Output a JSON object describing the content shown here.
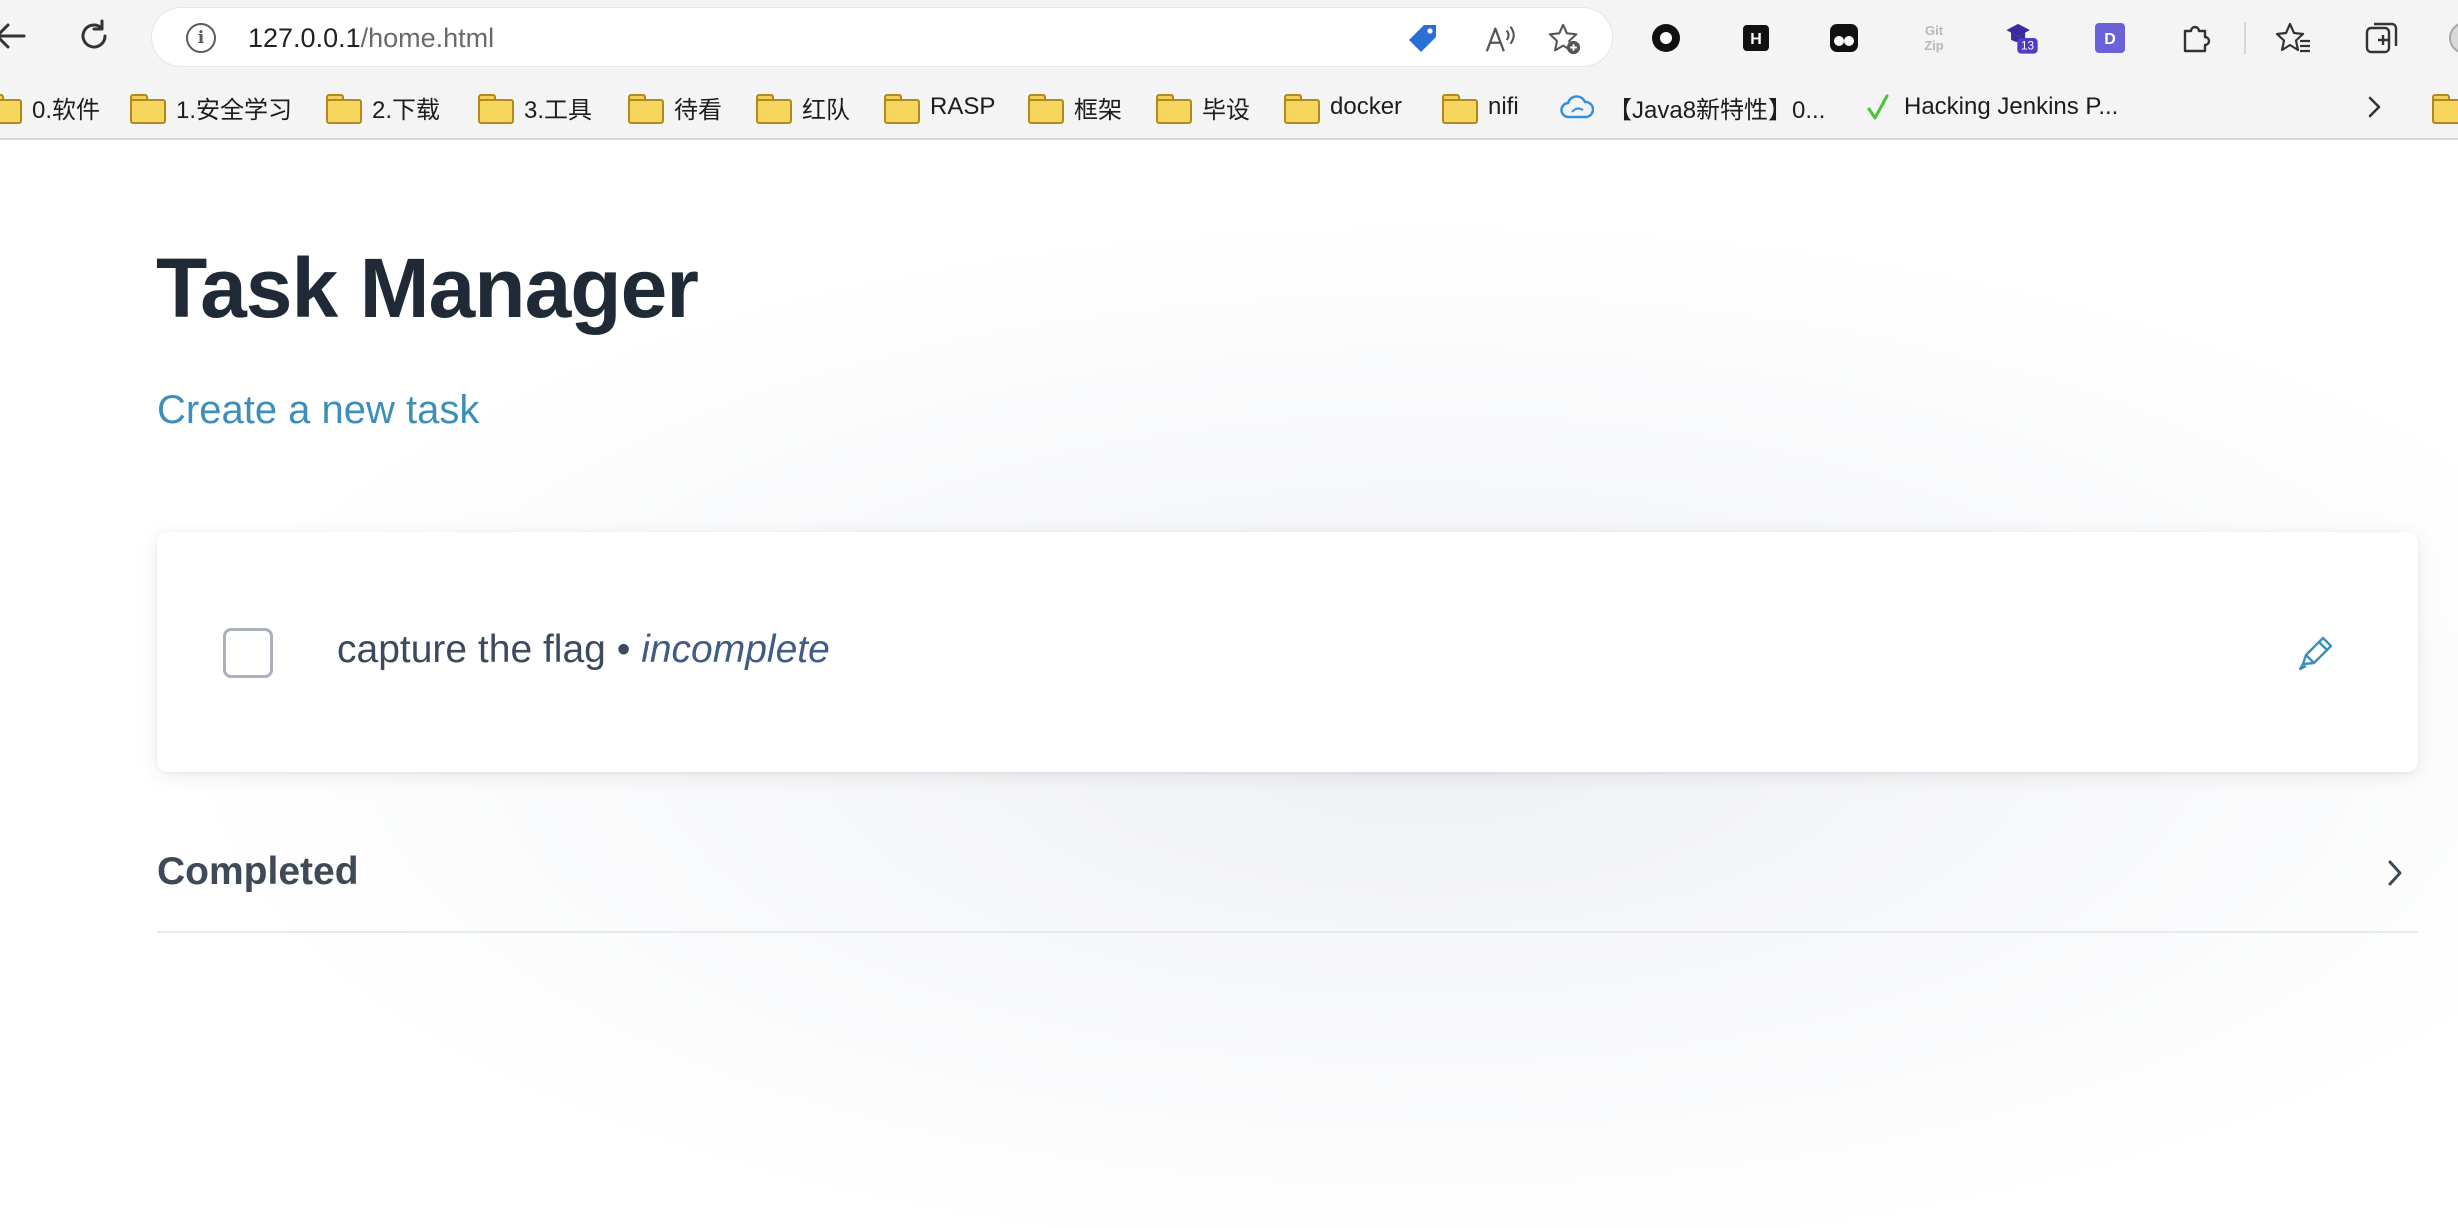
{
  "browser": {
    "url_host": "127.0.0.1",
    "url_path": "/home.html",
    "extension_badge": "13",
    "bookmarks": [
      {
        "label": "0.软件",
        "type": "folder"
      },
      {
        "label": "1.安全学习",
        "type": "folder"
      },
      {
        "label": "2.下载",
        "type": "folder"
      },
      {
        "label": "3.工具",
        "type": "folder"
      },
      {
        "label": "待看",
        "type": "folder"
      },
      {
        "label": "红队",
        "type": "folder"
      },
      {
        "label": "RASP",
        "type": "folder"
      },
      {
        "label": "框架",
        "type": "folder"
      },
      {
        "label": "毕设",
        "type": "folder"
      },
      {
        "label": "docker",
        "type": "folder"
      },
      {
        "label": "nifi",
        "type": "folder"
      },
      {
        "label": "【Java8新特性】0...",
        "type": "cloud-link"
      },
      {
        "label": "Hacking Jenkins P...",
        "type": "check-link"
      }
    ]
  },
  "page": {
    "title": "Task Manager",
    "create_link": "Create a new task",
    "tasks": [
      {
        "name": "capture the flag",
        "separator": "•",
        "status": "incomplete",
        "checked": false
      }
    ],
    "completed_section": "Completed"
  },
  "colors": {
    "title": "#1f2a36",
    "link": "#3d8fba",
    "status": "#3f5b86"
  }
}
